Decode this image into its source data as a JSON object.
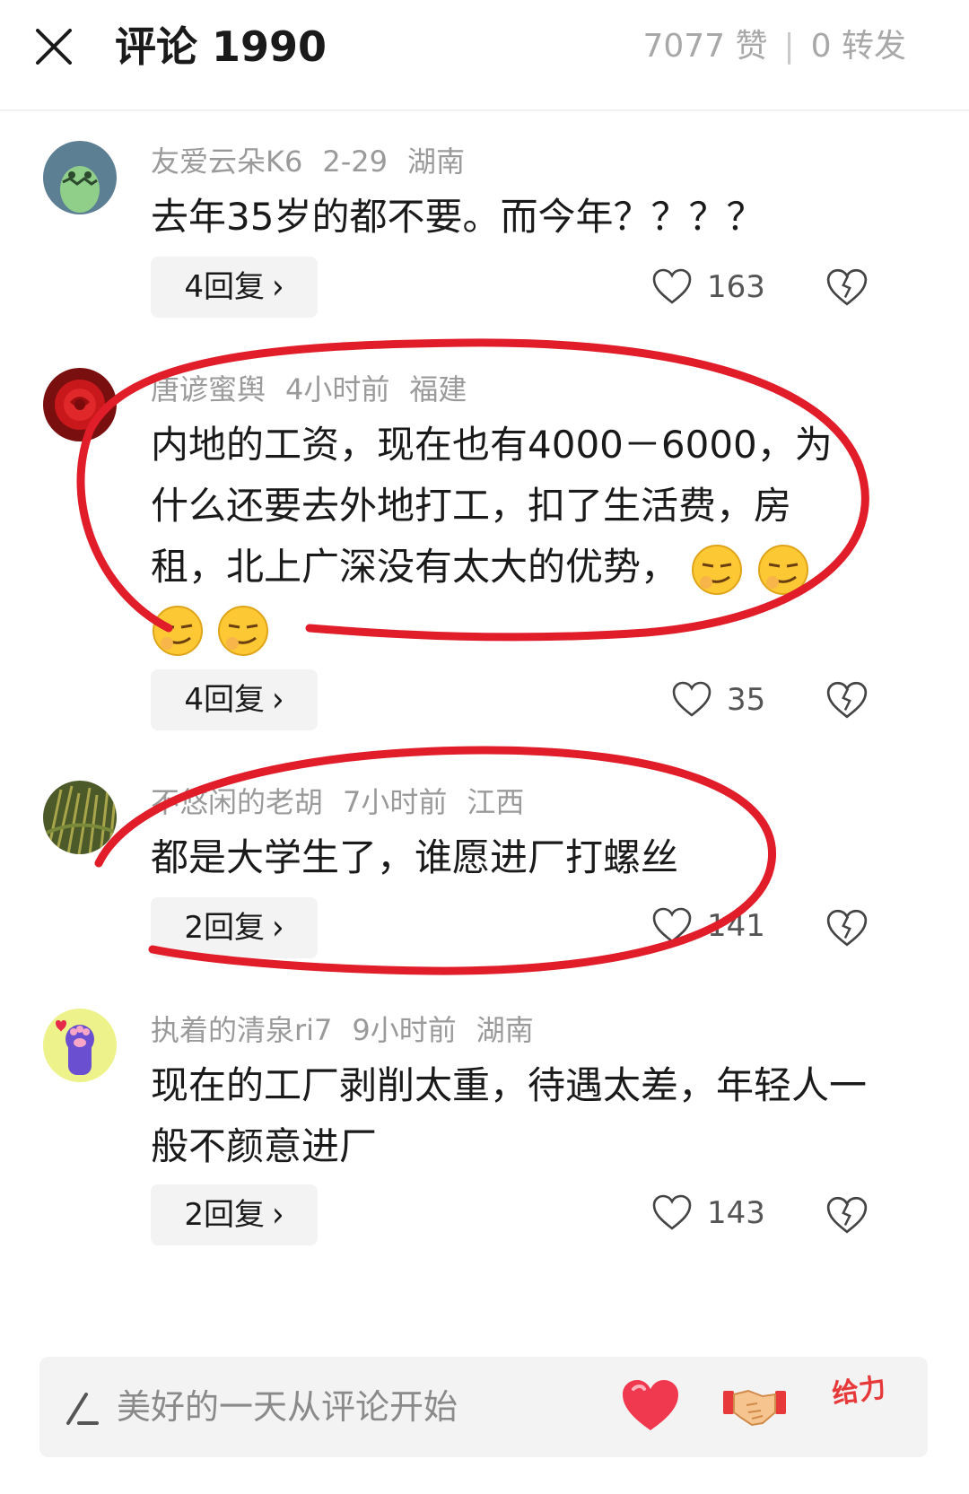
{
  "header": {
    "title": "评论 1990",
    "likes": "7077 赞",
    "separator": "|",
    "shares": "0 转发"
  },
  "comments": [
    {
      "user": "友爱云朵K6",
      "time": "2-29",
      "location": "湖南",
      "text": "去年35岁的都不要。而今年？？？？",
      "replies": "4回复",
      "likes": "163"
    },
    {
      "user": "唐谚蜜舆",
      "time": "4小时前",
      "location": "福建",
      "text": "内地的工资，现在也有4000－6000，为什么还要去外地打工，扣了生活费，房租，北上广深没有太大的优势，",
      "replies": "4回复",
      "likes": "35"
    },
    {
      "user": "不悠闲的老胡",
      "time": "7小时前",
      "location": "江西",
      "text": "都是大学生了，谁愿进厂打螺丝",
      "replies": "2回复",
      "likes": "141"
    },
    {
      "user": "执着的清泉ri7",
      "time": "9小时前",
      "location": "湖南",
      "text": "现在的工厂剥削太重，待遇太差，年轻人一般不颜意进厂",
      "replies": "2回复",
      "likes": "143"
    }
  ],
  "input": {
    "placeholder": "美好的一天从评论开始",
    "quick_reaction_geili": "给力"
  },
  "colors": {
    "annotation_red": "#e11d2a",
    "meta_gray": "#9a9a9a",
    "reply_bg": "#f3f3f3"
  }
}
